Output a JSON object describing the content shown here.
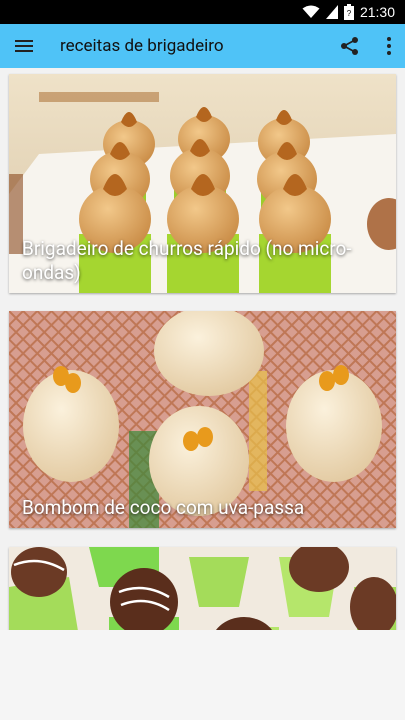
{
  "status_bar": {
    "time": "21:30",
    "icons": [
      "wifi-icon",
      "signal-icon",
      "battery-icon"
    ]
  },
  "app_bar": {
    "title": "receitas de brigadeiro",
    "icons": [
      "menu-icon",
      "share-icon",
      "more-vert-icon"
    ]
  },
  "recipes": [
    {
      "title": "Brigadeiro de churros rápido (no micro-ondas)"
    },
    {
      "title": "Bombom de coco com uva-passa"
    },
    {
      "title": ""
    }
  ],
  "colors": {
    "app_bar": "#4fc3f7",
    "status_bar": "#000000",
    "background": "#f2f2f2"
  }
}
